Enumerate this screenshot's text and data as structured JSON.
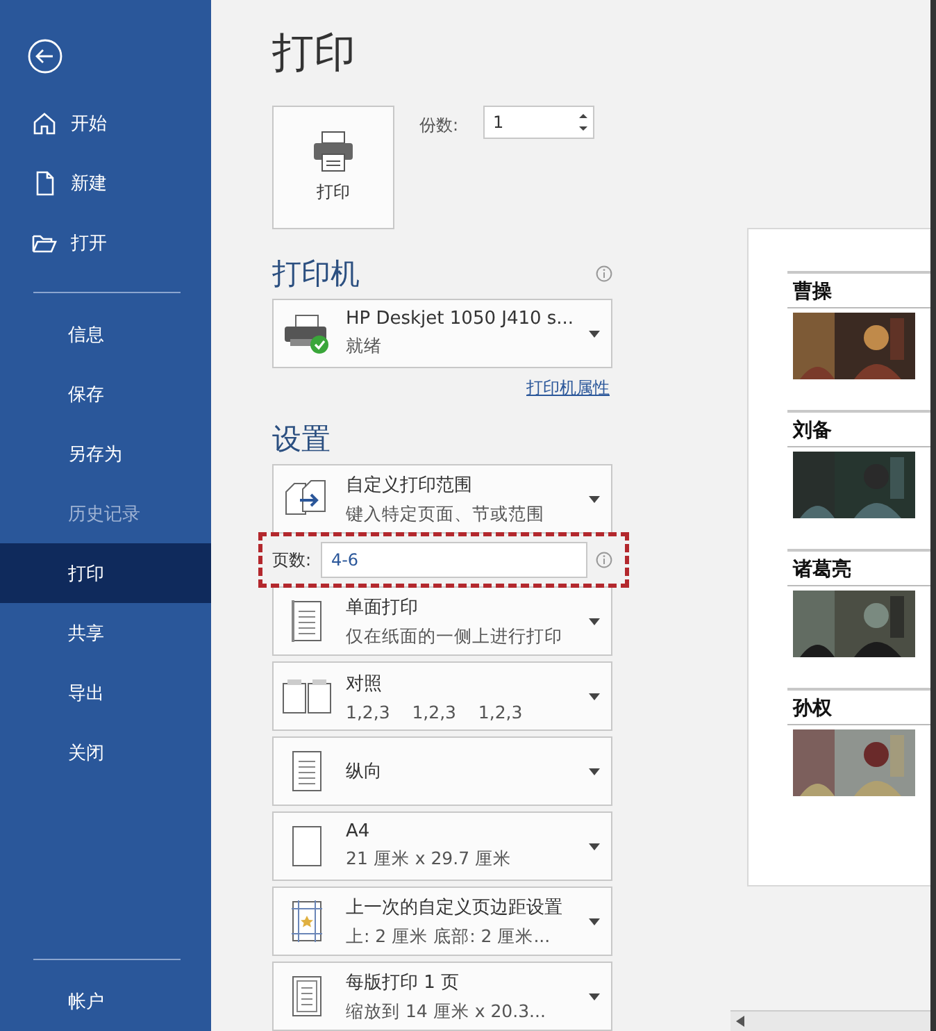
{
  "sidebar": {
    "nav_top": [
      {
        "kind": "home",
        "label": "开始"
      },
      {
        "kind": "new",
        "label": "新建"
      },
      {
        "kind": "open",
        "label": "打开"
      }
    ],
    "nav_main": [
      {
        "label": "信息",
        "selected": false,
        "disabled": false
      },
      {
        "label": "保存",
        "selected": false,
        "disabled": false
      },
      {
        "label": "另存为",
        "selected": false,
        "disabled": false
      },
      {
        "label": "历史记录",
        "selected": false,
        "disabled": true
      },
      {
        "label": "打印",
        "selected": true,
        "disabled": false
      },
      {
        "label": "共享",
        "selected": false,
        "disabled": false
      },
      {
        "label": "导出",
        "selected": false,
        "disabled": false
      },
      {
        "label": "关闭",
        "selected": false,
        "disabled": false
      }
    ],
    "bottom": [
      {
        "label": "帐户"
      }
    ]
  },
  "title": "打印",
  "print_button": "打印",
  "copies": {
    "label": "份数:",
    "value": "1"
  },
  "printer": {
    "heading": "打印机",
    "name": "HP Deskjet 1050 J410 s...",
    "status": "就绪",
    "properties_link": "打印机属性"
  },
  "settings": {
    "heading": "设置",
    "items": [
      {
        "kind": "range",
        "title": "自定义打印范围",
        "subtitle": "键入特定页面、节或范围"
      },
      {
        "kind": "pages-field",
        "label": "页数:",
        "value": "4-6",
        "highlighted": true
      },
      {
        "kind": "duplex",
        "title": "单面打印",
        "subtitle": "仅在纸面的一侧上进行打印"
      },
      {
        "kind": "collate",
        "title": "对照",
        "subtitle": "1,2,3    1,2,3    1,2,3"
      },
      {
        "kind": "orientation",
        "title": "纵向"
      },
      {
        "kind": "paper",
        "title": "A4",
        "subtitle": "21 厘米 x 29.7 厘米"
      },
      {
        "kind": "margins",
        "title": "上一次的自定义页边距设置",
        "subtitle": "上: 2 厘米 底部: 2 厘米..."
      },
      {
        "kind": "pages-per-sheet",
        "title": "每版打印 1 页",
        "subtitle": "缩放到 14 厘米 x 20.3..."
      }
    ]
  },
  "preview": {
    "entries": [
      {
        "name": "曹操"
      },
      {
        "name": "刘备"
      },
      {
        "name": "诸葛亮"
      },
      {
        "name": "孙权"
      }
    ]
  }
}
